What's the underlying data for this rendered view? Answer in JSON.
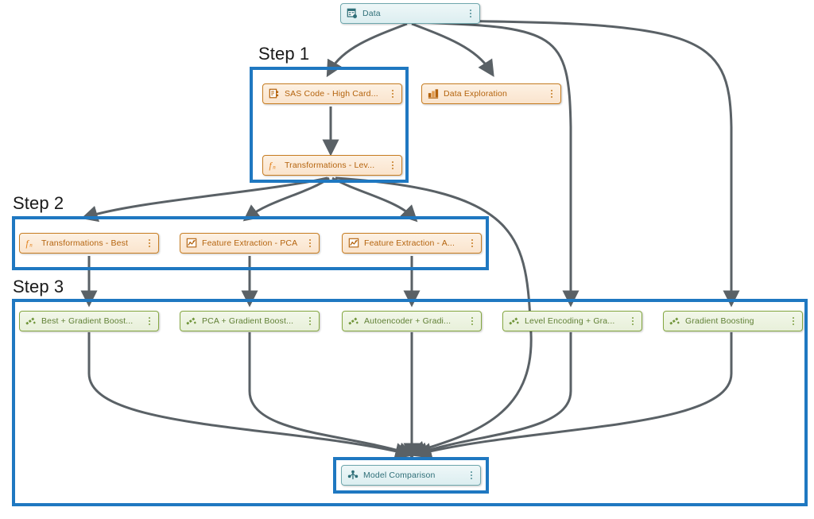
{
  "diagram": {
    "title": "Machine learning pipeline flow",
    "colors": {
      "highlight": "#1f78c1",
      "edge": "#5a6166",
      "teal_border": "#6fa7ad",
      "teal_text": "#2f6f78",
      "orange_border": "#c77d22",
      "orange_text": "#b4630d",
      "green_border": "#84a741",
      "green_text": "#5f7f33"
    },
    "step_labels": [
      {
        "text": "Step 1"
      },
      {
        "text": "Step 2"
      },
      {
        "text": "Step 3"
      }
    ],
    "nodes": [
      {
        "id": "data",
        "label": "Data",
        "icon": "table-data-icon",
        "theme": "teal"
      },
      {
        "id": "sas_code",
        "label": "SAS Code - High Card...",
        "icon": "sas-code-icon",
        "theme": "orange"
      },
      {
        "id": "data_expl",
        "label": "Data Exploration",
        "icon": "data-exploration-icon",
        "theme": "orange"
      },
      {
        "id": "trans_lev",
        "label": "Transformations - Lev...",
        "icon": "function-fx-icon",
        "theme": "orange"
      },
      {
        "id": "trans_best",
        "label": "Transformations - Best",
        "icon": "function-fx-icon",
        "theme": "orange"
      },
      {
        "id": "fe_pca",
        "label": "Feature Extraction - PCA",
        "icon": "feature-extraction-icon",
        "theme": "orange"
      },
      {
        "id": "fe_auto",
        "label": "Feature Extraction - A...",
        "icon": "feature-extraction-icon",
        "theme": "orange"
      },
      {
        "id": "best_gb",
        "label": "Best + Gradient Boost...",
        "icon": "model-gradient-icon",
        "theme": "green"
      },
      {
        "id": "pca_gb",
        "label": "PCA + Gradient Boost...",
        "icon": "model-gradient-icon",
        "theme": "green"
      },
      {
        "id": "auto_gb",
        "label": "Autoencoder + Gradi...",
        "icon": "model-gradient-icon",
        "theme": "green"
      },
      {
        "id": "level_gb",
        "label": "Level Encoding + Gra...",
        "icon": "model-gradient-icon",
        "theme": "green"
      },
      {
        "id": "gb",
        "label": "Gradient Boosting",
        "icon": "model-gradient-icon",
        "theme": "green"
      },
      {
        "id": "model_comp",
        "label": "Model Comparison",
        "icon": "model-comparison-icon",
        "theme": "teal"
      }
    ]
  }
}
